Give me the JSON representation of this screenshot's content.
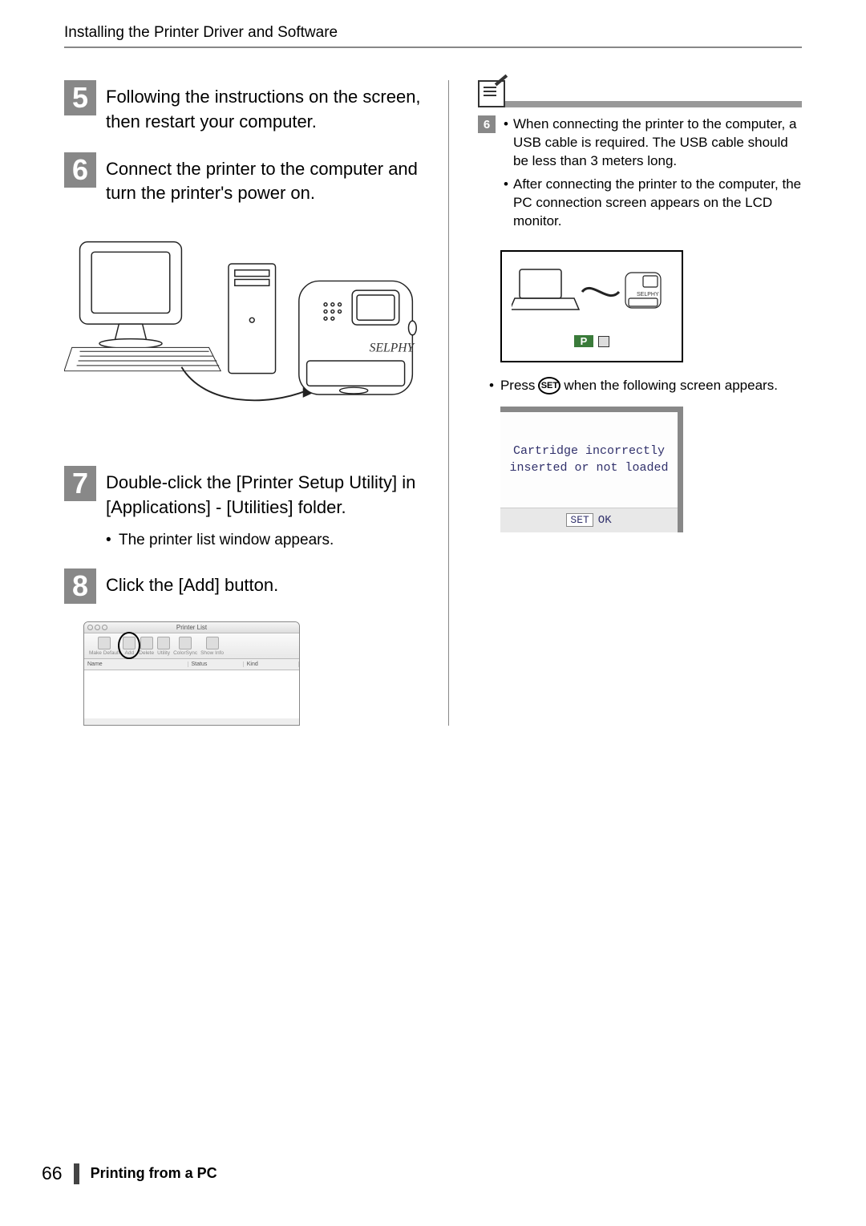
{
  "header": {
    "title": "Installing the Printer Driver and Software"
  },
  "steps": {
    "s5": {
      "num": "5",
      "text": "Following the instructions on the screen, then restart your computer."
    },
    "s6": {
      "num": "6",
      "text": "Connect the printer to the computer and turn the printer's power on."
    },
    "s7": {
      "num": "7",
      "text": "Double-click the [Printer Setup Utility] in [Applications] - [Utilities] folder.",
      "sub1": "The printer list window appears."
    },
    "s8": {
      "num": "8",
      "text": "Click the [Add] button."
    }
  },
  "printer_label": "SELPHY",
  "printer_list": {
    "title": "Printer List",
    "tool_make_default": "Make Default",
    "tool_add": "Add",
    "tool_delete": "Delete",
    "tool_utility": "Utility",
    "tool_colorsync": "ColorSync",
    "tool_showinfo": "Show Info",
    "col_name": "Name",
    "col_status": "Status",
    "col_kind": "Kind"
  },
  "sidebar": {
    "step6_num": "6",
    "bullet1": "When connecting the printer to the computer, a USB cable is required. The USB cable should be less than 3 meters long.",
    "bullet2": "After connecting the printer to the computer, the PC connection screen appears on the LCD monitor.",
    "lcd_p": "P",
    "lcd_selphy": "SELPHY",
    "press_pre": "Press",
    "set_label": "SET",
    "press_post": "when the following screen appears.",
    "error_line1": "Cartridge incorrectly",
    "error_line2": "inserted or not loaded",
    "error_set": "SET",
    "error_ok": "OK"
  },
  "footer": {
    "page": "66",
    "section": "Printing from a PC"
  }
}
